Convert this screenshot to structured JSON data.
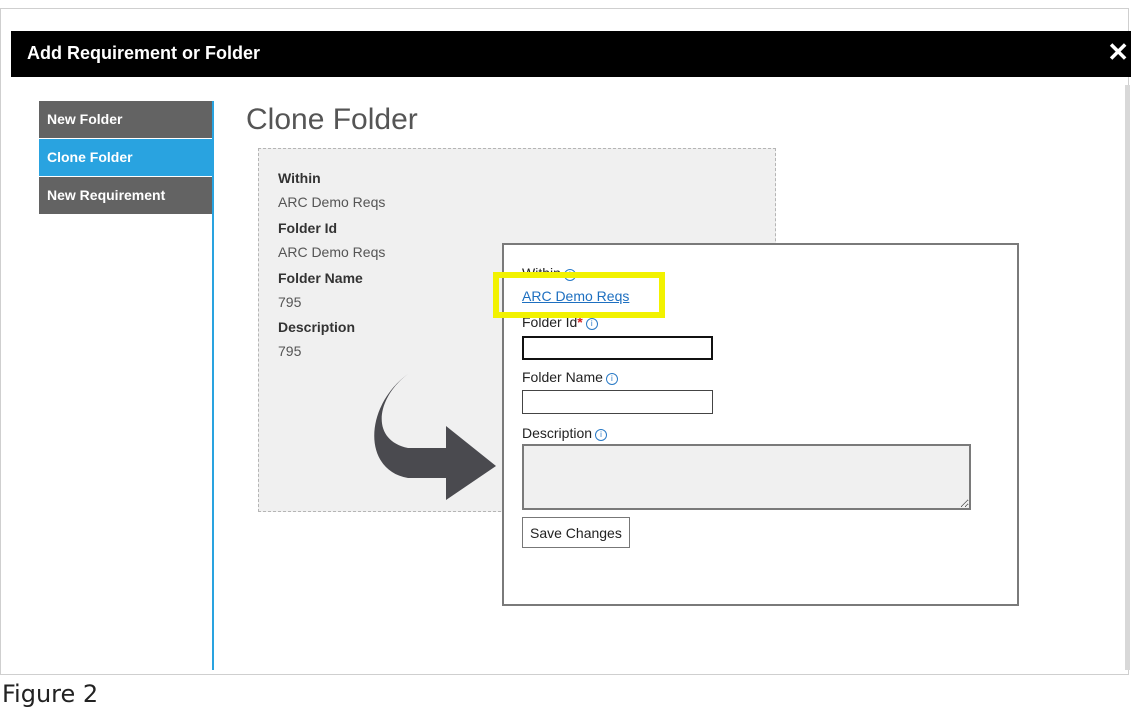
{
  "dialog": {
    "title": "Add Requirement or Folder",
    "close_glyph": "✕"
  },
  "sidebar": {
    "items": [
      {
        "label": "New Folder",
        "active": false
      },
      {
        "label": "Clone Folder",
        "active": true
      },
      {
        "label": "New Requirement",
        "active": false
      }
    ]
  },
  "page": {
    "title": "Clone Folder"
  },
  "source": {
    "within_label": "Within",
    "within_value": "ARC Demo Reqs",
    "folder_id_label": "Folder Id",
    "folder_id_value": "ARC Demo Reqs",
    "folder_name_label": "Folder Name",
    "folder_name_value": "795",
    "description_label": "Description",
    "description_value": "795"
  },
  "form": {
    "within_label": "Within",
    "within_link": "ARC Demo Reqs",
    "folder_id_label": "Folder Id",
    "required_marker": "*",
    "folder_id_value": "",
    "folder_name_label": "Folder Name",
    "folder_name_value": "",
    "description_label": "Description",
    "description_value": "",
    "save_button": "Save Changes",
    "info_glyph": "i"
  },
  "caption": "Figure 2",
  "colors": {
    "titlebar": "#000000",
    "sidebar_active": "#29a3e0",
    "sidebar_inactive": "#636363",
    "highlight": "#f2f200",
    "arrow": "#4a4a4f",
    "link": "#1d6fc0"
  },
  "icons": {
    "close": "close-icon",
    "arrow": "curved-arrow-icon",
    "info": "info-icon"
  }
}
